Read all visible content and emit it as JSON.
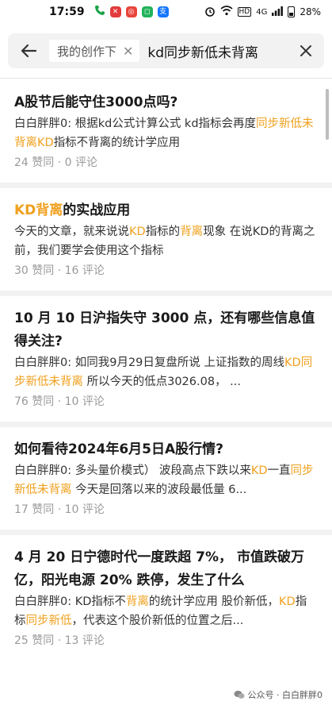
{
  "status_bar": {
    "time": "17:59",
    "battery": "28%",
    "network": "4G"
  },
  "search": {
    "scope_chip": "我的创作下",
    "query": "kd同步新低未背离"
  },
  "results": [
    {
      "title": [
        {
          "t": "A股节后能守住3000点吗?",
          "h": false
        }
      ],
      "snippet": [
        {
          "t": "白白胖胖0: 根据kd公式计算公式 kd指标会再度",
          "h": false
        },
        {
          "t": "同步新低未背离KD",
          "h": true
        },
        {
          "t": "指标不背离的统计学应用",
          "h": false
        }
      ],
      "meta": "24 赞同 · 0 评论"
    },
    {
      "title": [
        {
          "t": "KD背离",
          "h": true
        },
        {
          "t": "的实战应用",
          "h": false
        }
      ],
      "snippet": [
        {
          "t": "今天的文章，就来说说",
          "h": false
        },
        {
          "t": "KD",
          "h": true
        },
        {
          "t": "指标的",
          "h": false
        },
        {
          "t": "背离",
          "h": true
        },
        {
          "t": "现象 在说KD的背离之前，我们要学会使用这个指标",
          "h": false
        }
      ],
      "meta": "30 赞同 · 16 评论"
    },
    {
      "title": [
        {
          "t": "10 月 10 日沪指失守 3000 点，还有哪些信息值得关注?",
          "h": false
        }
      ],
      "snippet": [
        {
          "t": "白白胖胖0: 如同我9月29日复盘所说 上证指数的周线",
          "h": false
        },
        {
          "t": "KD同步新低未背离",
          "h": true
        },
        {
          "t": " 所以今天的低点3026.08， ...",
          "h": false
        }
      ],
      "meta": "76 赞同 · 10 评论"
    },
    {
      "title": [
        {
          "t": "如何看待2024年6月5日A股行情?",
          "h": false
        }
      ],
      "snippet": [
        {
          "t": "白白胖胖0: 多头量价模式） 波段高点下跌以来",
          "h": false
        },
        {
          "t": "KD",
          "h": true
        },
        {
          "t": "一直",
          "h": false
        },
        {
          "t": "同步新低未背离",
          "h": true
        },
        {
          "t": " 今天是回落以来的波段最低量 6...",
          "h": false
        }
      ],
      "meta": "17 赞同 · 10 评论"
    },
    {
      "title": [
        {
          "t": "4 月 20 日宁德时代一度跌超 7%， 市值跌破万亿，阳光电源 20% 跌停，发生了什么",
          "h": false
        }
      ],
      "snippet": [
        {
          "t": "白白胖胖0: KD指标不",
          "h": false
        },
        {
          "t": "背离",
          "h": true
        },
        {
          "t": "的统计学应用 股价新低，",
          "h": false
        },
        {
          "t": "KD",
          "h": true
        },
        {
          "t": "指标",
          "h": false
        },
        {
          "t": "同步新低",
          "h": true
        },
        {
          "t": "，代表这个股价新低的位置之后...",
          "h": false
        }
      ],
      "meta": "25 赞同 · 13 评论"
    }
  ],
  "watermark": "公众号 · 白白胖胖0",
  "colors": {
    "highlight": "#f0a01e",
    "muted": "#9a9a9a",
    "separator": "#f2f2f2"
  }
}
